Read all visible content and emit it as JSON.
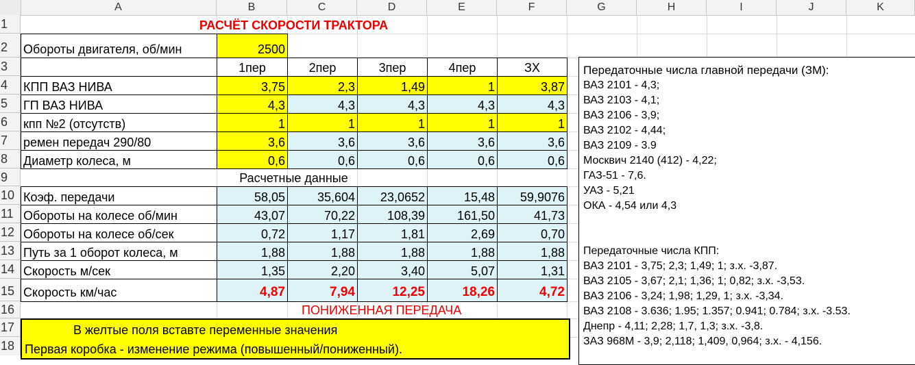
{
  "columns": [
    "A",
    "B",
    "C",
    "D",
    "E",
    "F",
    "G",
    "H",
    "I",
    "J",
    "K"
  ],
  "rows": [
    "1",
    "2",
    "3",
    "4",
    "5",
    "6",
    "7",
    "8",
    "9",
    "10",
    "11",
    "12",
    "13",
    "14",
    "15",
    "16",
    "17",
    "18"
  ],
  "title": "РАСЧЁТ СКОРОСТИ ТРАКТОРА",
  "engine": {
    "label": "Обороты двигателя, об/мин",
    "value": "2500"
  },
  "gear_headers": [
    "1пер",
    "2пер",
    "3пер",
    "4пер",
    "ЗХ"
  ],
  "input_rows": [
    {
      "label": "КПП ВАЗ НИВА",
      "values": [
        "3,75",
        "2,3",
        "1,49",
        "1",
        "3,87"
      ]
    },
    {
      "label": "ГП ВАЗ  НИВА",
      "values": [
        "4,3",
        "4,3",
        "4,3",
        "4,3",
        "4,3"
      ]
    },
    {
      "label": "кпп №2 (отсутств)",
      "values": [
        "1",
        "1",
        "1",
        "1",
        "1"
      ]
    },
    {
      "label": "ремен передач 290/80",
      "values": [
        "3,6",
        "3,6",
        "3,6",
        "3,6",
        "3,6"
      ]
    },
    {
      "label": "Диаметр колеса,  м",
      "values": [
        "0,6",
        "0,6",
        "0,6",
        "0,6",
        "0,6"
      ]
    }
  ],
  "calc_header": "Расчетные данные",
  "calc_rows": [
    {
      "label": "Коэф. передачи",
      "values": [
        "58,05",
        "35,604",
        "23,0652",
        "15,48",
        "59,9076"
      ]
    },
    {
      "label": "Обороты  на колесе об/мин",
      "values": [
        "43,07",
        "70,22",
        "108,39",
        "161,50",
        "41,73"
      ]
    },
    {
      "label": "Обороты  на колесе об/сек",
      "values": [
        "0,72",
        "1,17",
        "1,81",
        "2,69",
        "0,70"
      ]
    },
    {
      "label": "Путь за 1 оборот колеса, м",
      "values": [
        "1,88",
        "1,88",
        "1,88",
        "1,88",
        "1,88"
      ]
    },
    {
      "label": "Скорость м/сек",
      "values": [
        "1,35",
        "2,20",
        "3,40",
        "5,07",
        "1,31"
      ]
    },
    {
      "label": "Скорость км/час",
      "values": [
        "4,87",
        "7,94",
        "12,25",
        "18,26",
        "4,72"
      ]
    }
  ],
  "lower_gear": "ПОНИЖЕННАЯ ПЕРЕДАЧА",
  "note_lines": [
    "В желтые поля  вставте переменные  значения",
    "Первая коробка - изменение  режима  (повышенный/пониженный)."
  ],
  "info_main_title": "Передаточные  числа  главной  передачи  (ЗМ):",
  "info_main": [
    "ВАЗ 2101 - 4,3;",
    "ВАЗ 2103 - 4,1;",
    "ВАЗ 2106 - 3,9;",
    "ВАЗ 2102 - 4,44;",
    "ВАЗ 2109 - 3.9",
    "Москвич 2140 (412) - 4,22;",
    "ГАЗ-51 - 7,6.",
    "УАЗ - 5,21",
    "ОКА - 4,54 или  4,3"
  ],
  "info_kpp_title": "Передаточные числа КПП:",
  "info_kpp": [
    "ВАЗ 2101 - 3,75; 2,3; 1,49; 1; з.х. -3,87.",
    "ВАЗ 2105 - 3,67; 2,1; 1,36; 1; 0,82; з.х. -3,53.",
    "ВАЗ 2106 - 3,24; 1,98; 1,29, 1; з.х. -3,34.",
    "ВАЗ 2108 - 3.636; 1.95; 1.357; 0.941; 0.784; з.х. -3.53.",
    "Днепр - 4,11; 2,28; 1,7, 1,3; з.х. -3,8.",
    "ЗАЗ 968М - 3,9; 2,118; 1,409, 0,964; з.х. - 4,156."
  ]
}
